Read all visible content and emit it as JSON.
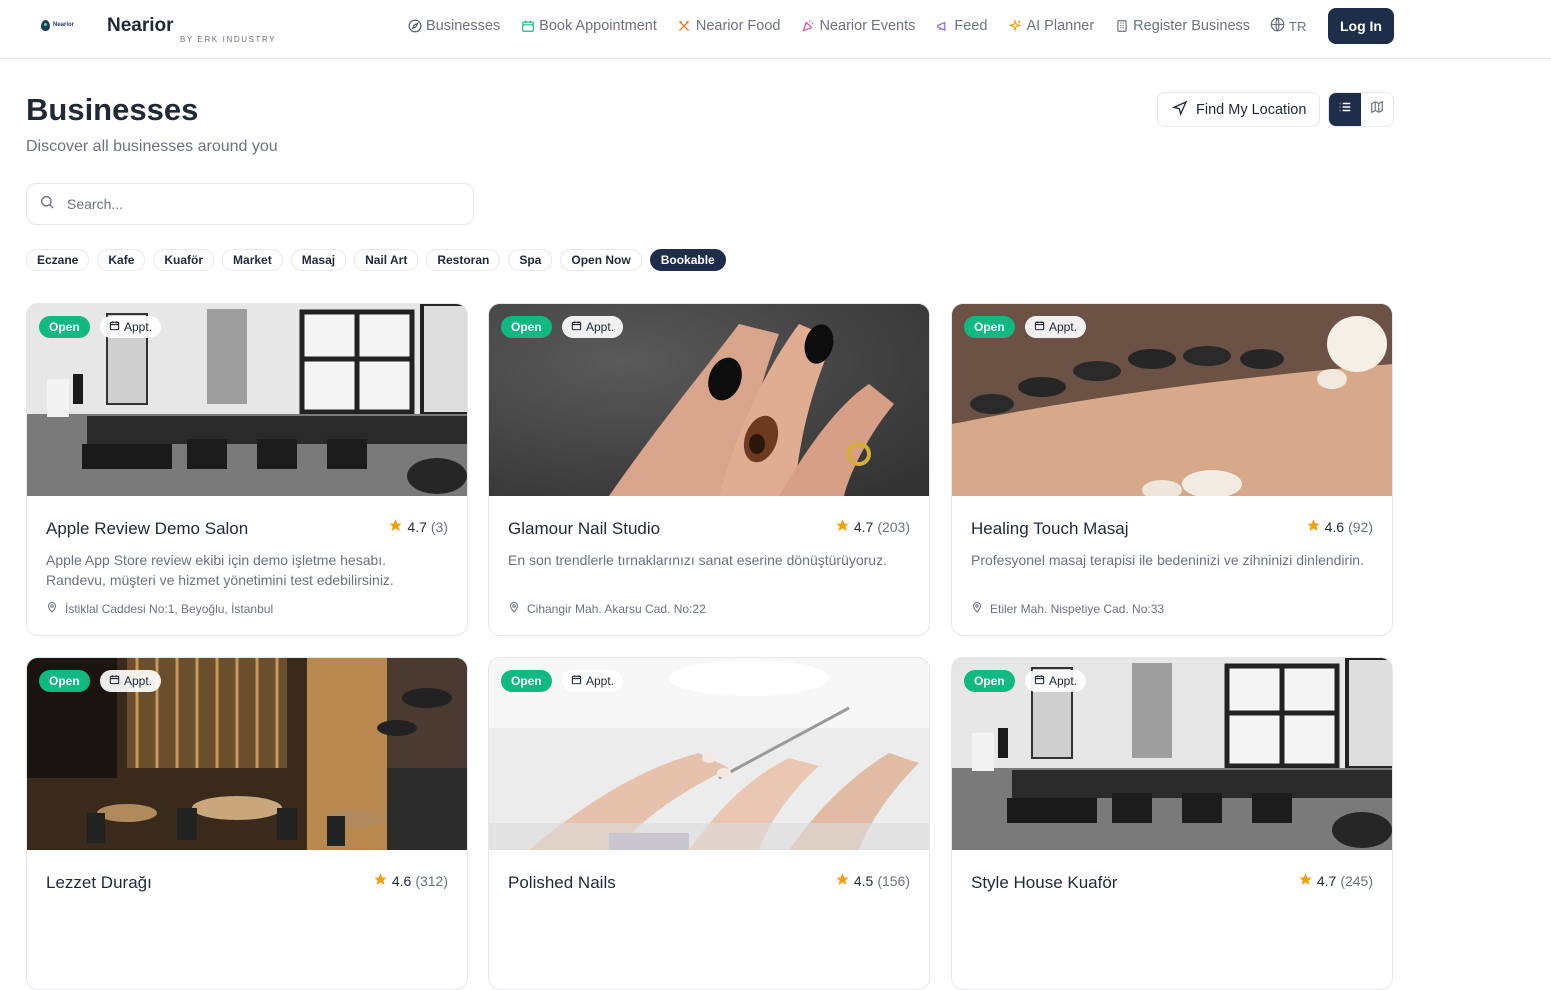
{
  "nav": {
    "brand_name": "Nearior",
    "brand_sub": "BY ERK INDUSTRY",
    "logo_text": "Nearior",
    "links": [
      {
        "label": "Businesses",
        "icon": "compass-icon"
      },
      {
        "label": "Book Appointment",
        "icon": "calendar-icon"
      },
      {
        "label": "Nearior Food",
        "icon": "utensils-icon"
      },
      {
        "label": "Nearior Events",
        "icon": "party-popper-icon"
      },
      {
        "label": "Feed",
        "icon": "megaphone-icon"
      },
      {
        "label": "AI Planner",
        "icon": "sparkles-icon"
      },
      {
        "label": "Register Business",
        "icon": "building-icon"
      }
    ],
    "language": "TR",
    "login_label": "Log In"
  },
  "header": {
    "title": "Businesses",
    "subtitle": "Discover all businesses around you",
    "find_location_label": "Find My Location"
  },
  "search": {
    "placeholder": "Search..."
  },
  "filters": [
    "Eczane",
    "Kafe",
    "Kuaför",
    "Market",
    "Masaj",
    "Nail Art",
    "Restoran",
    "Spa",
    "Open Now",
    "Bookable"
  ],
  "active_filter": "Bookable",
  "badges": {
    "open": "Open",
    "appt": "Appt."
  },
  "cards": [
    {
      "name": "Apple Review Demo Salon",
      "rating": "4.7",
      "count": "(3)",
      "desc": "Apple App Store review ekibi için demo işletme hesabı. Randevu, müşteri ve hizmet yönetimini test edebilirsiniz.",
      "address": "İstiklal Caddesi No:1, Beyoğlu, İstanbul"
    },
    {
      "name": "Glamour Nail Studio",
      "rating": "4.7",
      "count": "(203)",
      "desc": "En son trendlerle tırnaklarınızı sanat eserine dönüştürüyoruz.",
      "address": "Cihangir Mah. Akarsu Cad. No:22"
    },
    {
      "name": "Healing Touch Masaj",
      "rating": "4.6",
      "count": "(92)",
      "desc": "Profesyonel masaj terapisi ile bedeninizi ve zihninizi dinlendirin.",
      "address": "Etiler Mah. Nispetiye Cad. No:33"
    },
    {
      "name": "Lezzet Durağı",
      "rating": "4.6",
      "count": "(312)",
      "desc": "",
      "address": ""
    },
    {
      "name": "Polished Nails",
      "rating": "4.5",
      "count": "(156)",
      "desc": "",
      "address": ""
    },
    {
      "name": "Style House Kuaför",
      "rating": "4.7",
      "count": "(245)",
      "desc": "",
      "address": ""
    }
  ],
  "colors": {
    "primary": "#1e2d4a",
    "open_badge": "#10b981",
    "star": "#f59e0b"
  }
}
